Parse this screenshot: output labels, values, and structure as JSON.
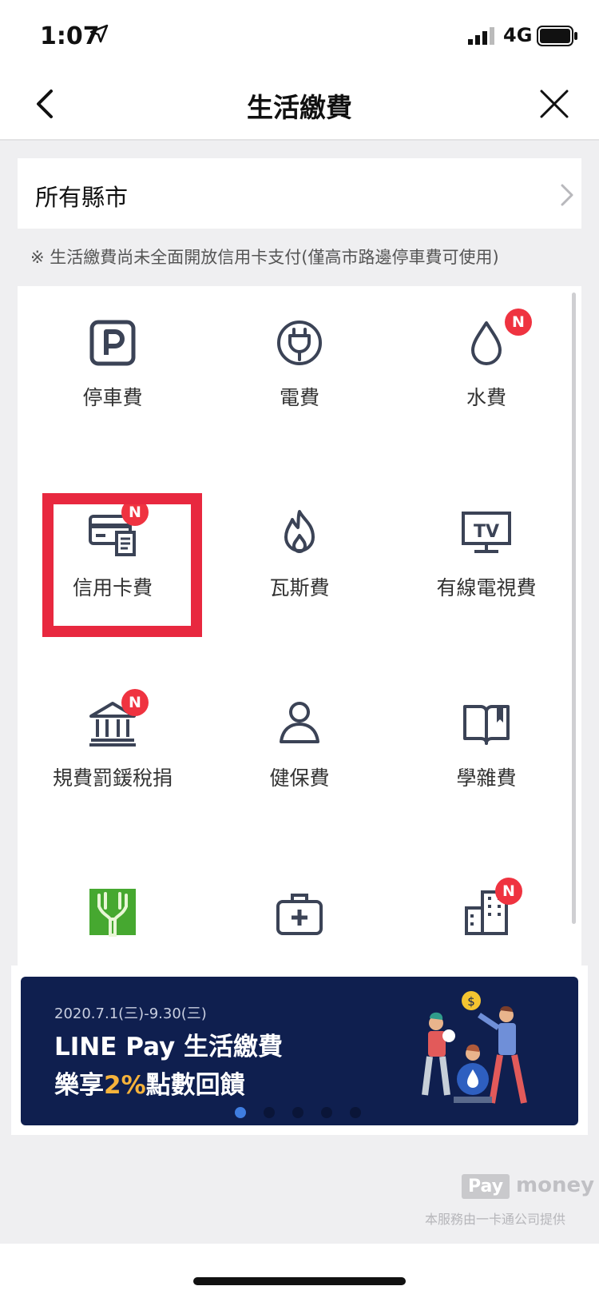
{
  "status_bar": {
    "time": "1:07",
    "network": "4G"
  },
  "nav": {
    "title": "生活繳費"
  },
  "city_selector": {
    "label": "所有縣市"
  },
  "notice": "※ 生活繳費尚未全面開放信用卡支付(僅高市路邊停車費可使用)",
  "categories": [
    {
      "label": "停車費",
      "icon": "parking-icon",
      "badge": ""
    },
    {
      "label": "電費",
      "icon": "electric-plug-icon",
      "badge": ""
    },
    {
      "label": "水費",
      "icon": "water-drop-icon",
      "badge": "N"
    },
    {
      "label": "信用卡費",
      "icon": "credit-card-icon",
      "badge": "N"
    },
    {
      "label": "瓦斯費",
      "icon": "flame-icon",
      "badge": ""
    },
    {
      "label": "有線電視費",
      "icon": "tv-icon",
      "badge": ""
    },
    {
      "label": "規費罰鍰稅捐",
      "icon": "government-building-icon",
      "badge": "N"
    },
    {
      "label": "健保費",
      "icon": "person-icon",
      "badge": ""
    },
    {
      "label": "學雜費",
      "icon": "book-icon",
      "badge": ""
    },
    {
      "label": "",
      "icon": "deer-park-icon",
      "badge": ""
    },
    {
      "label": "",
      "icon": "medical-kit-icon",
      "badge": ""
    },
    {
      "label": "",
      "icon": "office-building-icon",
      "badge": "N"
    }
  ],
  "banner": {
    "date": "2020.7.1(三)-9.30(三)",
    "line1": "LINE Pay 生活繳費",
    "line2_prefix": "樂享",
    "line2_highlight": "2%",
    "line2_suffix": "點數回饋",
    "highlight_color": "#f6b33b",
    "slides": 5,
    "active_slide": 1
  },
  "footer": {
    "logo_pay": "Pay",
    "logo_money": "money",
    "note": "本服務由一卡通公司提供"
  },
  "colors": {
    "badge": "#ef3340",
    "highlight_box": "#e8283f",
    "banner_bg": "#0f1f4f",
    "icon_stroke": "#3b4356"
  }
}
